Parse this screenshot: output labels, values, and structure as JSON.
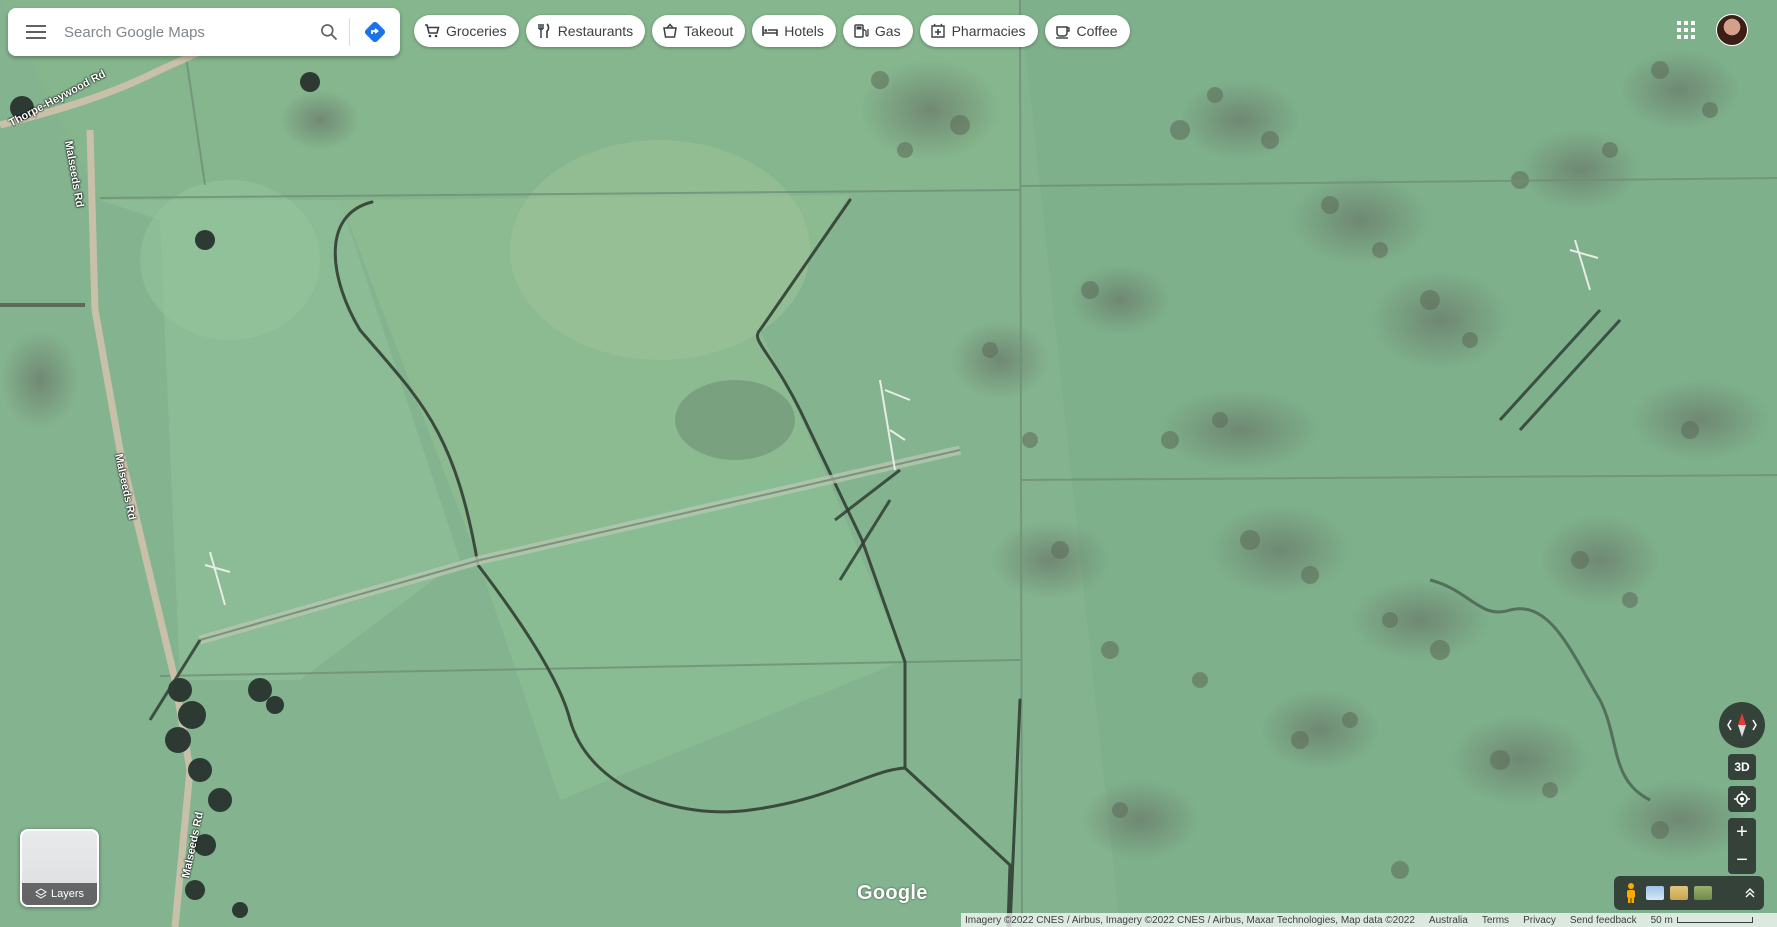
{
  "search": {
    "placeholder": "Search Google Maps"
  },
  "chips": [
    {
      "label": "Groceries",
      "icon": "cart-icon"
    },
    {
      "label": "Restaurants",
      "icon": "fork-knife-icon"
    },
    {
      "label": "Takeout",
      "icon": "takeout-icon"
    },
    {
      "label": "Hotels",
      "icon": "bed-icon"
    },
    {
      "label": "Gas",
      "icon": "gas-pump-icon"
    },
    {
      "label": "Pharmacies",
      "icon": "pharmacy-icon"
    },
    {
      "label": "Coffee",
      "icon": "coffee-cup-icon"
    }
  ],
  "roads": {
    "road1": "Thorpe-Heywood Rd",
    "road2": "Malseeds Rd",
    "road3": "Malseeds Rd",
    "road4": "Malseeds Rd"
  },
  "layers": {
    "label": "Layers"
  },
  "controls": {
    "three_d": "3D",
    "zoom_in": "+",
    "zoom_out": "−"
  },
  "logo": "Google",
  "footer": {
    "attribution": "Imagery ©2022 CNES / Airbus, Imagery ©2022 CNES / Airbus, Maxar Technologies, Map data ©2022",
    "region": "Australia",
    "terms": "Terms",
    "privacy": "Privacy",
    "feedback": "Send feedback",
    "scale": "50 m"
  },
  "colors": {
    "accent": "#1a73e8",
    "map_base": "#7fae8a"
  }
}
